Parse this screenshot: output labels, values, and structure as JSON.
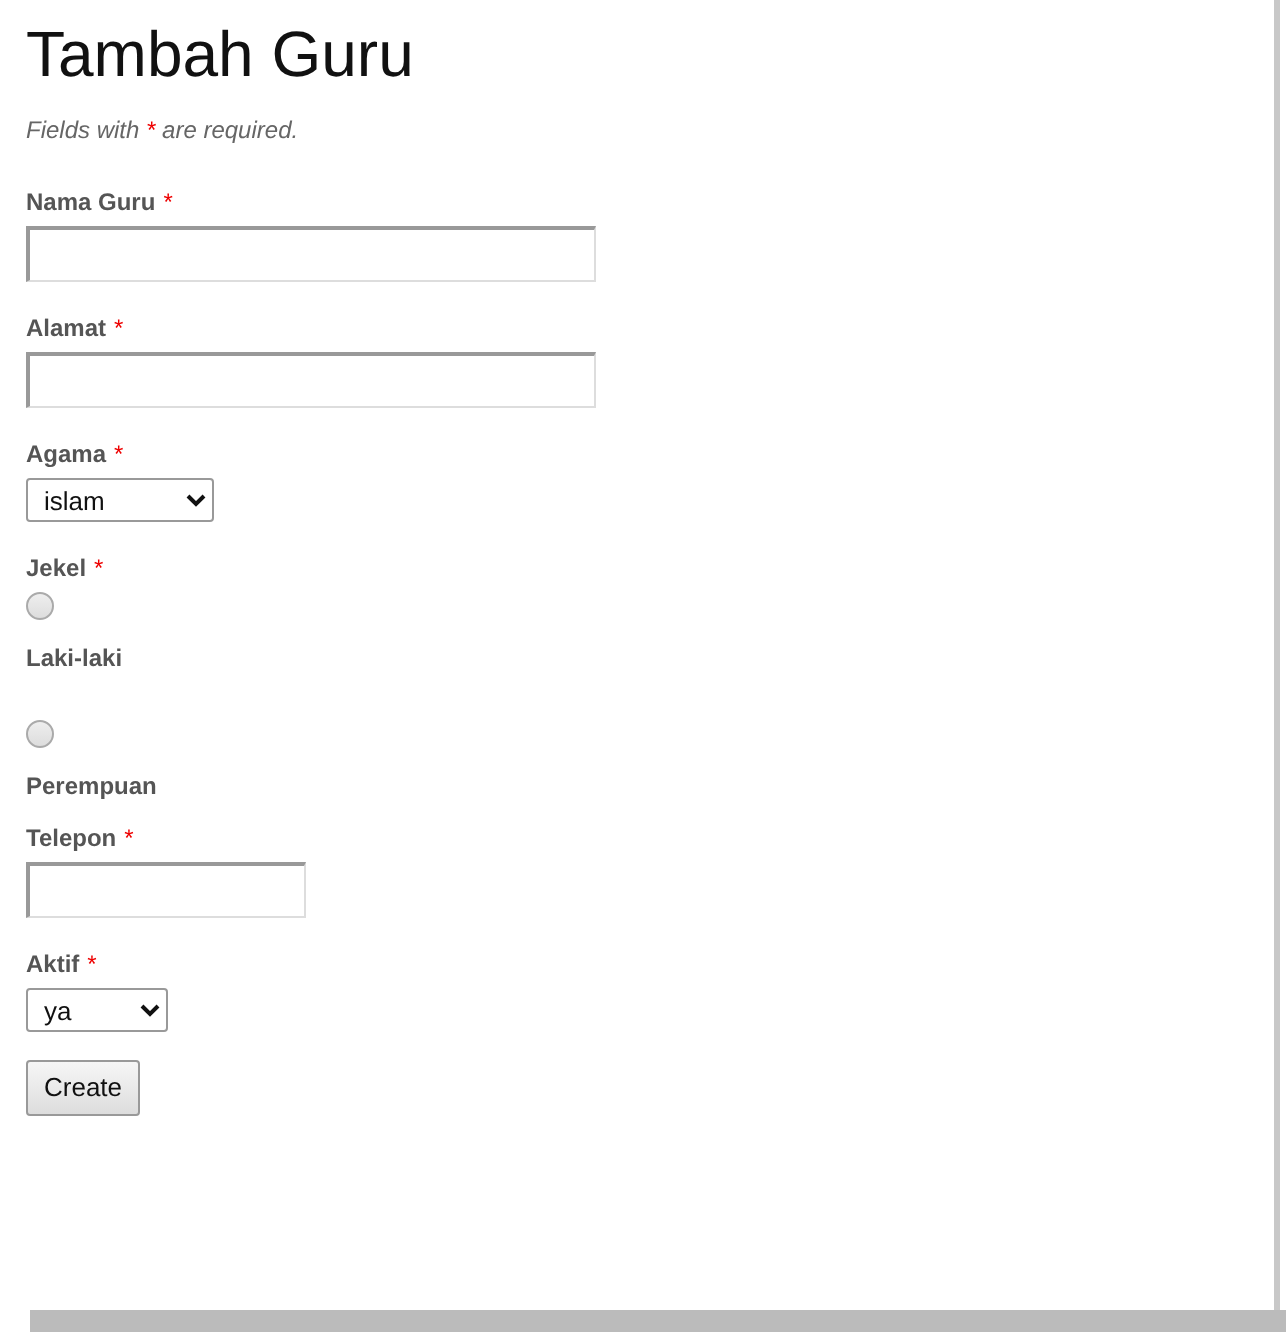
{
  "title": "Tambah Guru",
  "note": {
    "before": "Fields with ",
    "mark": "*",
    "after": " are required."
  },
  "fields": [
    {
      "kind": "text",
      "label": "Nama Guru",
      "required": true
    },
    {
      "kind": "text",
      "label": "Alamat",
      "required": true
    },
    {
      "kind": "select",
      "label": "Agama",
      "required": true,
      "value": "islam"
    },
    {
      "kind": "radio",
      "label": "Jekel",
      "required": true,
      "options": [
        {
          "label": "Laki-laki",
          "selected": false
        },
        {
          "label": "Perempuan",
          "selected": false
        }
      ]
    },
    {
      "kind": "text",
      "label": "Telepon",
      "required": true
    },
    {
      "kind": "select",
      "label": "Aktif",
      "required": true,
      "value": "ya"
    }
  ],
  "submit": "Create"
}
